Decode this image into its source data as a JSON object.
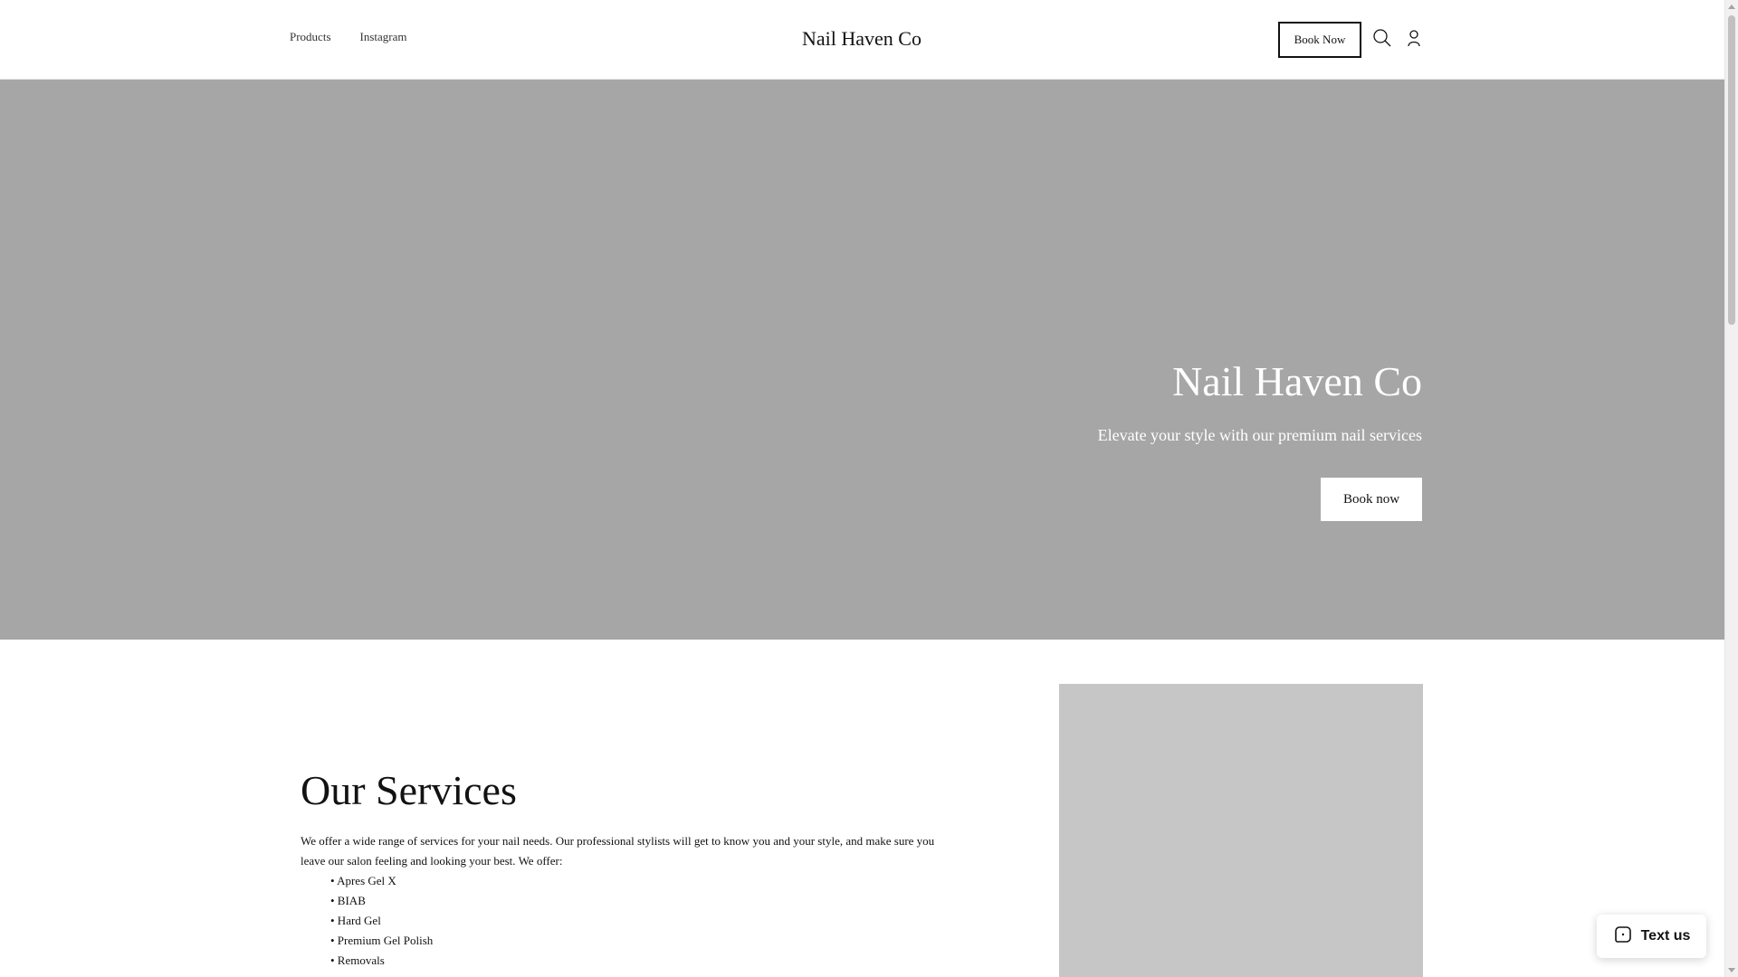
{
  "header": {
    "nav": [
      "Products",
      "Instagram"
    ],
    "brand": "Nail Haven Co",
    "book_label": "Book Now",
    "search_icon": "search-icon",
    "account_icon": "account-icon"
  },
  "hero": {
    "title": "Nail Haven Co",
    "subtitle": "Elevate your style with our premium nail services",
    "button_label": "Book now"
  },
  "services": {
    "title": "Our Services",
    "description": "We offer a wide range of services for your nail needs. Our professional stylists will get to know you and your style, and make sure you leave our salon feeling and looking your best. We offer:",
    "items": [
      "• Apres Gel X",
      "• BIAB",
      "• Hard Gel",
      "• Premium Gel Polish",
      "• Removals"
    ]
  },
  "widget": {
    "label": "Text us",
    "icon": "chat-bubble-icon"
  },
  "colors": {
    "hero_bg": "#a6a6a6",
    "image_placeholder": "#c6c6c6",
    "text": "#121212"
  }
}
